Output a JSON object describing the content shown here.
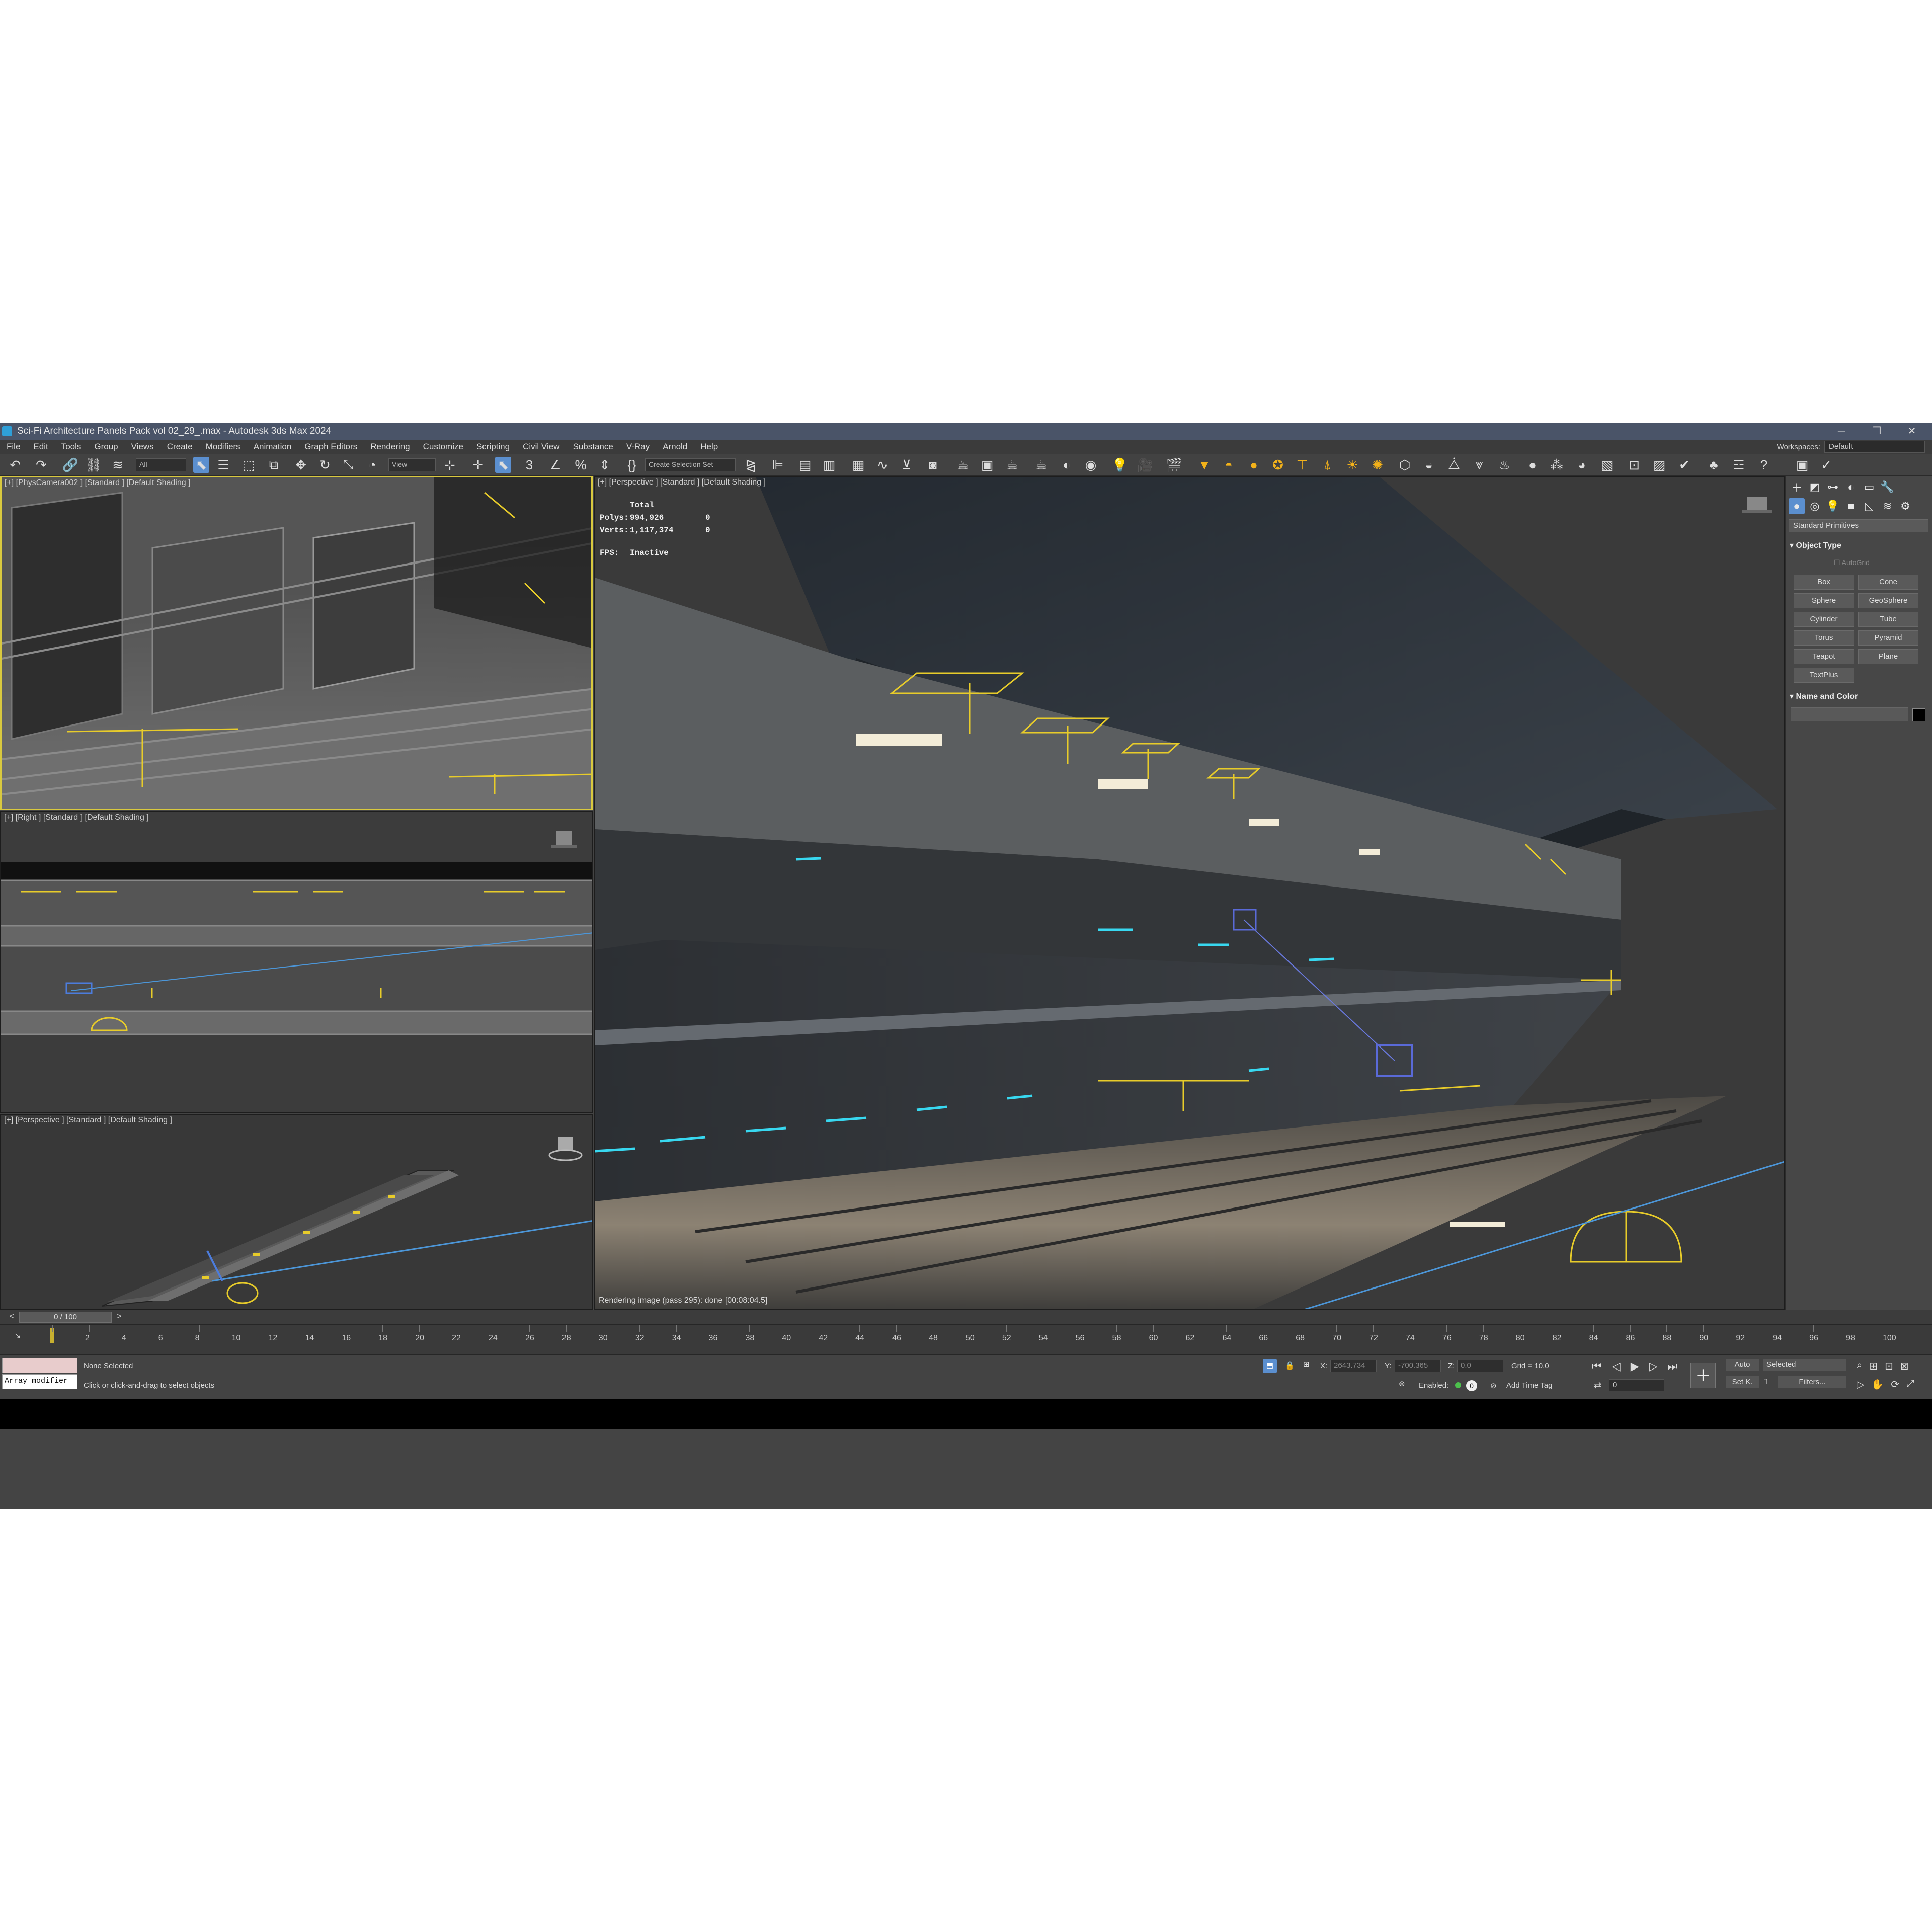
{
  "window": {
    "title": "Sci-Fi Architecture Panels Pack vol 02_29_.max - Autodesk 3ds Max 2024",
    "minimize": "─",
    "restore": "❐",
    "close": "✕"
  },
  "menu": [
    "File",
    "Edit",
    "Tools",
    "Group",
    "Views",
    "Create",
    "Modifiers",
    "Animation",
    "Graph Editors",
    "Rendering",
    "Customize",
    "Scripting",
    "Civil View",
    "Substance",
    "V-Ray",
    "Arnold",
    "Help"
  ],
  "workspaces": {
    "label": "Workspaces:",
    "value": "Default"
  },
  "toolbar": {
    "filter_value": "All",
    "refcoord_value": "View",
    "selection_set_placeholder": "Create Selection Set",
    "snap_label": "3",
    "percent_icon": "%"
  },
  "viewports": {
    "top_left": {
      "label": "[+] [PhysCamera002 ] [Standard ] [Default Shading ]"
    },
    "mid_left": {
      "label": "[+] [Right ] [Standard ] [Default Shading ]"
    },
    "bottom_left": {
      "label": "[+] [Perspective ] [Standard ] [Default Shading ]"
    },
    "main": {
      "label": "[+] [Perspective ] [Standard ] [Default Shading ]",
      "stats_header": "Total",
      "polys_label": "Polys:",
      "polys_value": "994,926",
      "polys_sel": "0",
      "verts_label": "Verts:",
      "verts_value": "1,117,374",
      "verts_sel": "0",
      "fps_label": "FPS:",
      "fps_value": "Inactive",
      "render_status": "Rendering image (pass 295): done [00:08:04.5]"
    }
  },
  "command_panel": {
    "category": "Standard Primitives",
    "object_type_title": "Object Type",
    "autogrid": "AutoGrid",
    "buttons": [
      "Box",
      "Cone",
      "Sphere",
      "GeoSphere",
      "Cylinder",
      "Tube",
      "Torus",
      "Pyramid",
      "Teapot",
      "Plane",
      "TextPlus"
    ],
    "name_color_title": "Name and Color"
  },
  "timeline": {
    "slider_label": "0 / 100",
    "prev": "<",
    "next": ">",
    "ticks": [
      "0",
      "2",
      "4",
      "6",
      "8",
      "10",
      "12",
      "14",
      "16",
      "18",
      "20",
      "22",
      "24",
      "26",
      "28",
      "30",
      "32",
      "34",
      "36",
      "38",
      "40",
      "42",
      "44",
      "46",
      "48",
      "50",
      "52",
      "54",
      "56",
      "58",
      "60",
      "62",
      "64",
      "66",
      "68",
      "70",
      "72",
      "74",
      "76",
      "78",
      "80",
      "82",
      "84",
      "86",
      "88",
      "90",
      "92",
      "94",
      "96",
      "98",
      "100"
    ]
  },
  "status": {
    "maxscript": "Array modifier",
    "selection": "None Selected",
    "prompt": "Click or click-and-drag to select objects",
    "x_label": "X:",
    "x_value": "2643.734",
    "y_label": "Y:",
    "y_value": "-700.365",
    "z_label": "Z:",
    "z_value": "0.0",
    "grid": "Grid = 10.0",
    "enabled_label": "Enabled:",
    "enabled_value": "0",
    "add_time_tag": "Add Time Tag",
    "auto_key": "Auto",
    "set_key": "Set K.",
    "selected": "Selected",
    "filters": "Filters...",
    "frame_value": "0"
  }
}
